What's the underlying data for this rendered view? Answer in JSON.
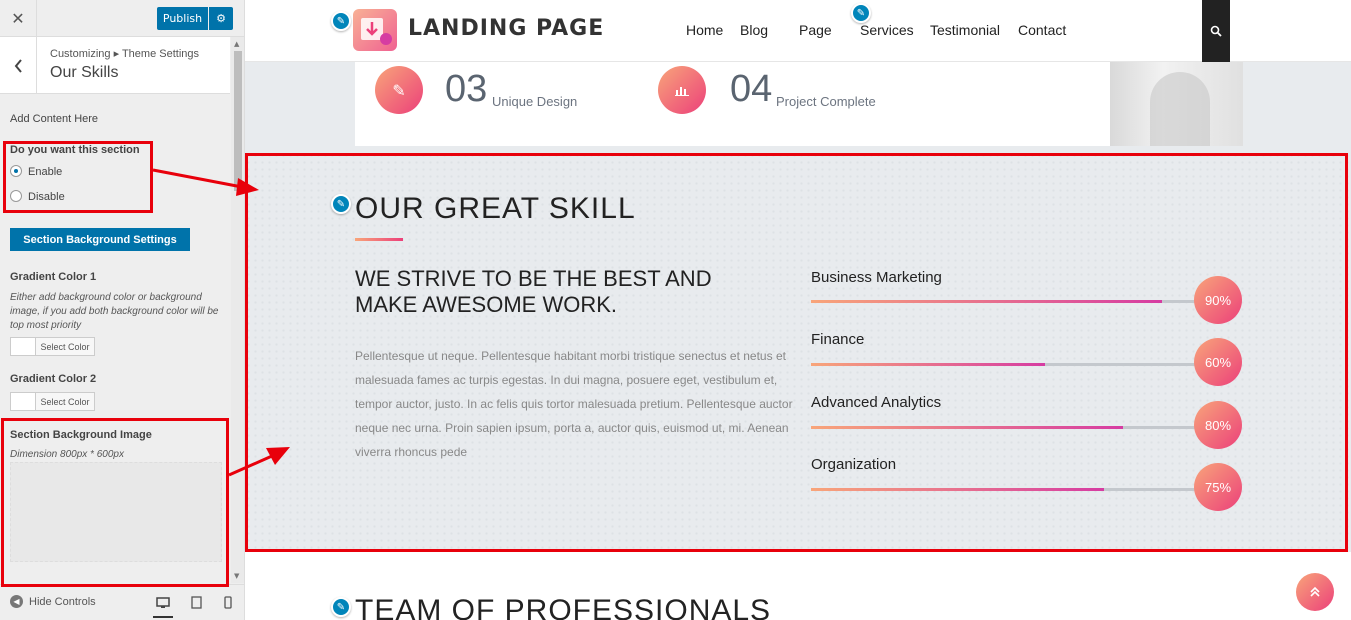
{
  "sidebar": {
    "close_glyph": "✕",
    "publish_label": "Publish",
    "breadcrumb": "Customizing ▸ Theme Settings",
    "panel_title": "Our Skills",
    "add_content": "Add Content Here",
    "section_toggle_label": "Do you want this section",
    "enable_label": "Enable",
    "disable_label": "Disable",
    "bg_settings_button": "Section Background Settings",
    "gradient1_label": "Gradient Color 1",
    "gradient1_hint": "Either add background color or background image, if you add both background color will be top most priority",
    "select_color_label": "Select Color",
    "gradient2_label": "Gradient Color 2",
    "bg_image_label": "Section Background Image",
    "bg_image_hint": "Dimension 800px * 600px",
    "hide_controls": "Hide Controls",
    "accent_color": "#0073aa"
  },
  "nav": {
    "logo_text": "LANDING PAGE",
    "items": [
      "Home",
      "Blog",
      "Page",
      "Services",
      "Testimonial",
      "Contact"
    ]
  },
  "stats": [
    {
      "number": "03",
      "label": "Unique Design"
    },
    {
      "number": "04",
      "label": "Project Complete"
    }
  ],
  "skills": {
    "title": "OUR GREAT SKILL",
    "heading": "WE STRIVE TO BE THE BEST AND MAKE AWESOME WORK.",
    "paragraph": "Pellentesque ut neque. Pellentesque habitant morbi tristique senectus et netus et malesuada fames ac turpis egestas. In dui magna, posuere eget, vestibulum et, tempor auctor, justo. In ac felis quis tortor malesuada pretium. Pellentesque auctor neque nec urna. Proin sapien ipsum, porta a, auctor quis, euismod ut, mi. Aenean viverra rhoncus pede",
    "items": [
      {
        "name": "Business Marketing",
        "percent": "90%",
        "value": 0.9
      },
      {
        "name": "Finance",
        "percent": "60%",
        "value": 0.6
      },
      {
        "name": "Advanced Analytics",
        "percent": "80%",
        "value": 0.8
      },
      {
        "name": "Organization",
        "percent": "75%",
        "value": 0.75
      }
    ],
    "gradient_start": "#f8a57a",
    "gradient_end": "#ec407a"
  },
  "team": {
    "title": "TEAM OF PROFESSIONALS"
  },
  "highlight_color": "#e8000b"
}
